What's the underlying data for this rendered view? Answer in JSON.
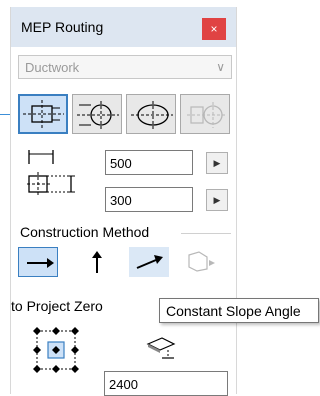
{
  "window": {
    "title": "MEP Routing",
    "close_glyph": "×"
  },
  "system_dropdown": {
    "value": "Ductwork",
    "chevron_icon": "chevron-down-icon"
  },
  "shapes": [
    {
      "name": "rectangular-duct",
      "selected": true
    },
    {
      "name": "circular-duct",
      "selected": false
    },
    {
      "name": "oval-duct",
      "selected": false
    },
    {
      "name": "transition-duct",
      "selected": false,
      "disabled": true
    }
  ],
  "dimensions": {
    "width": "500",
    "height": "300",
    "width_icon": "width-dimension-icon",
    "height_icon": "height-dimension-icon"
  },
  "construction_method": {
    "label": "Construction Method",
    "methods": [
      {
        "name": "horizontal",
        "selected": true
      },
      {
        "name": "vertical",
        "selected": false
      },
      {
        "name": "constant-slope",
        "selected": false
      },
      {
        "name": "free",
        "selected": false,
        "disabled": true
      }
    ]
  },
  "reference": {
    "label": "to Project Zero",
    "elevation": "2400"
  },
  "tooltip": {
    "text": "Constant Slope Angle"
  },
  "colors": {
    "accent": "#3a7fc1",
    "selected_bg": "#cde1f7",
    "close_red": "#e04343"
  }
}
